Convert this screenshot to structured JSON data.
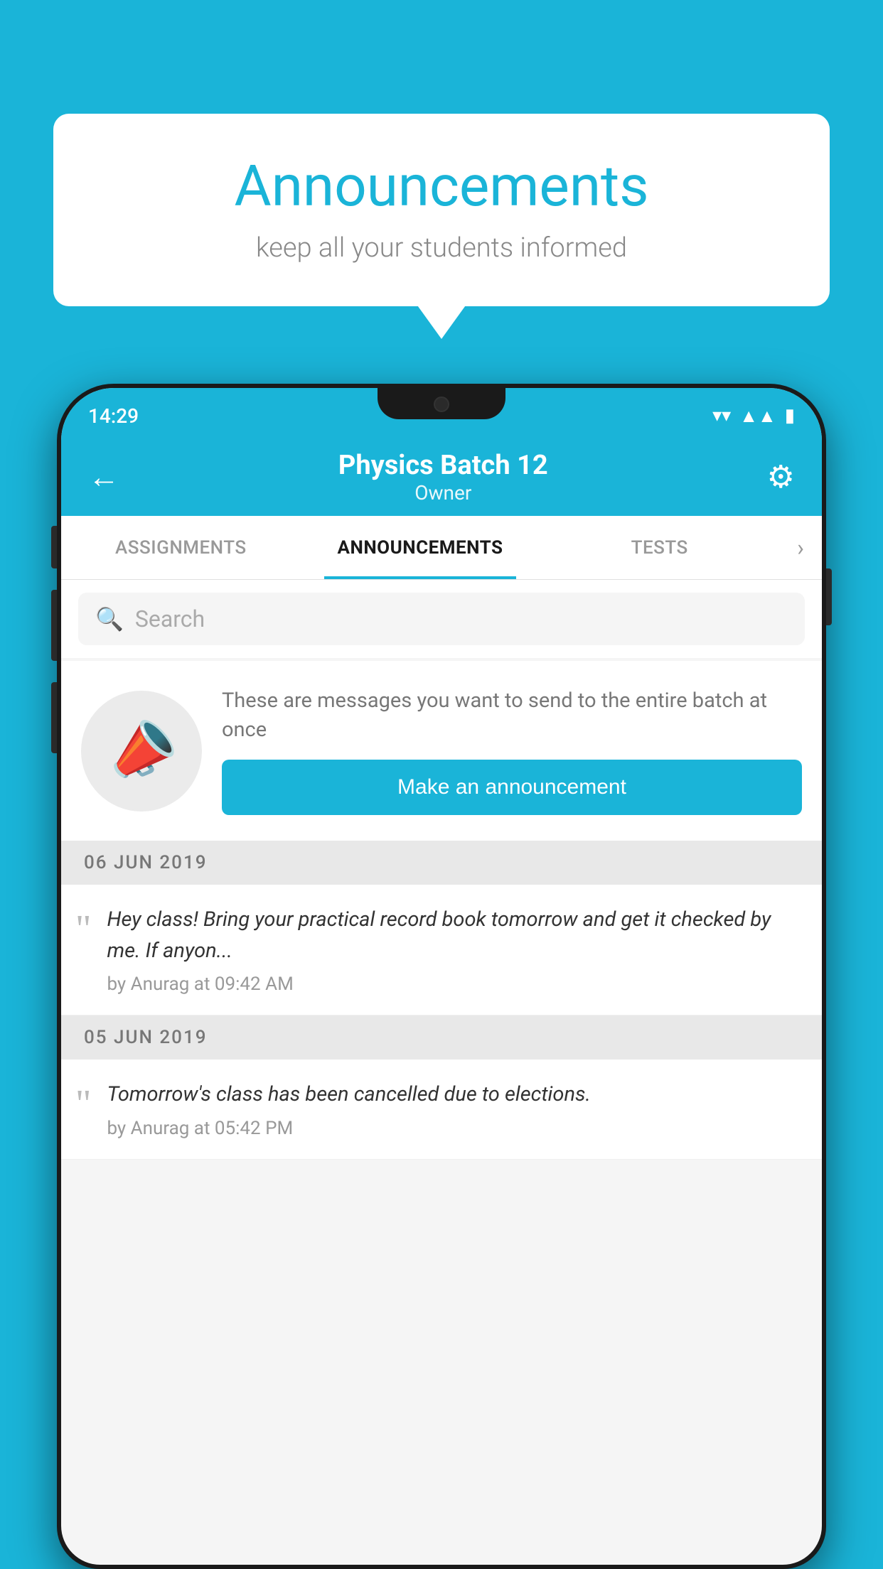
{
  "background_color": "#1ab4d8",
  "bubble": {
    "title": "Announcements",
    "subtitle": "keep all your students informed"
  },
  "status_bar": {
    "time": "14:29",
    "wifi_icon": "wifi",
    "signal_icon": "signal",
    "battery_icon": "battery"
  },
  "app_bar": {
    "title": "Physics Batch 12",
    "subtitle": "Owner",
    "back_label": "←",
    "gear_label": "⚙"
  },
  "tabs": [
    {
      "label": "ASSIGNMENTS",
      "active": false
    },
    {
      "label": "ANNOUNCEMENTS",
      "active": true
    },
    {
      "label": "TESTS",
      "active": false
    }
  ],
  "search": {
    "placeholder": "Search"
  },
  "announcement_card": {
    "description": "These are messages you want to send to the entire batch at once",
    "button_label": "Make an announcement"
  },
  "messages": [
    {
      "date": "06  JUN  2019",
      "text": "Hey class! Bring your practical record book tomorrow and get it checked by me. If anyon...",
      "meta": "by Anurag at 09:42 AM"
    },
    {
      "date": "05  JUN  2019",
      "text": "Tomorrow's class has been cancelled due to elections.",
      "meta": "by Anurag at 05:42 PM"
    }
  ]
}
